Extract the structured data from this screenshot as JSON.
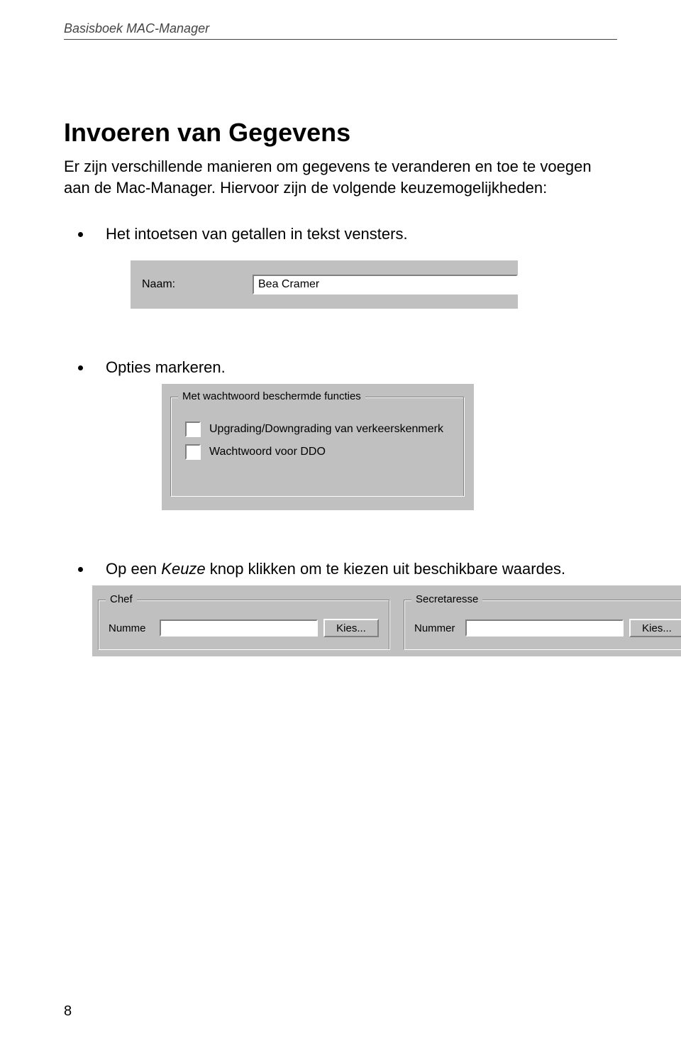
{
  "header": {
    "running_title": "Basisboek MAC-Manager"
  },
  "title": "Invoeren van Gegevens",
  "intro": "Er zijn verschillende manieren om gegevens te veranderen en toe te voegen aan de Mac-Manager. Hiervoor zijn de volgende keuzemogelijkheden:",
  "bullets": [
    "Het intoetsen van getallen in tekst vensters.",
    "Opties markeren.",
    {
      "pre": "Op een ",
      "italic": "Keuze",
      "post": " knop klikken om te kiezen uit beschikbare waardes."
    }
  ],
  "screenshots": {
    "name_field": {
      "label": "Naam:",
      "value": "Bea Cramer"
    },
    "checkbox_group": {
      "legend": "Met wachtwoord beschermde functies",
      "items": [
        {
          "label": "Upgrading/Downgrading van verkeerskenmerk",
          "checked": false
        },
        {
          "label": "Wachtwoord voor DDO",
          "checked": false
        }
      ]
    },
    "keuze": {
      "left": {
        "legend": "Chef",
        "number_label": "Numme",
        "number_value": "",
        "button": "Kies..."
      },
      "right": {
        "legend": "Secretaresse",
        "number_label": "Nummer",
        "number_value": "",
        "button": "Kies..."
      }
    }
  },
  "page_number": "8"
}
